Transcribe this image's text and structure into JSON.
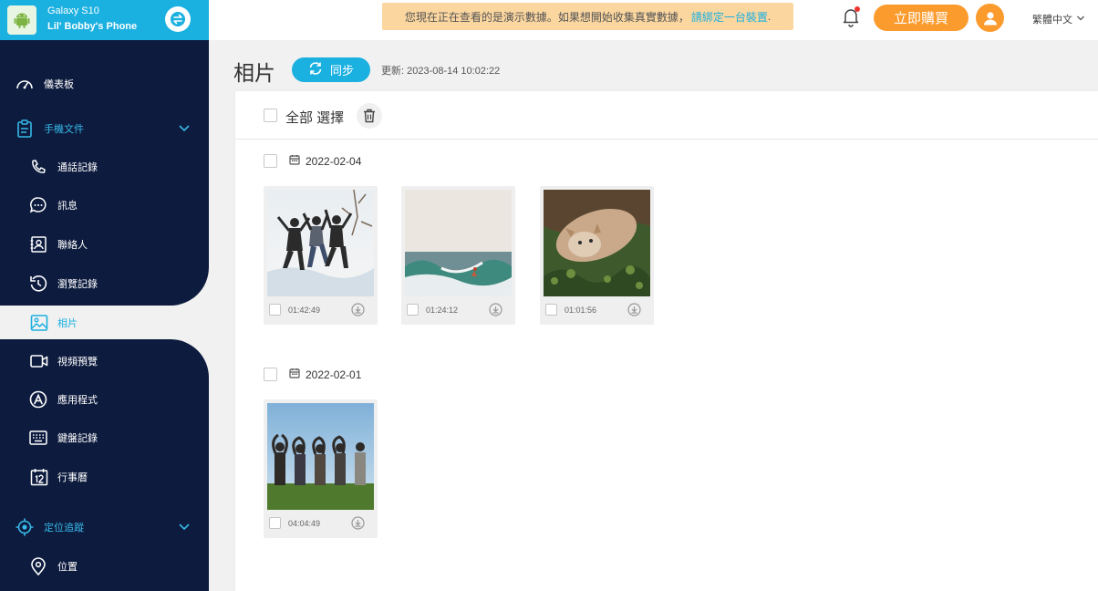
{
  "device": {
    "model": "Galaxy S10",
    "owner": "Lil' Bobby's Phone"
  },
  "sidebar": {
    "items": [
      {
        "label": "儀表板",
        "icon": "dashboard-icon"
      },
      {
        "label": "手機文件",
        "icon": "phone-files-icon",
        "group": true
      },
      {
        "label": "通話記錄",
        "icon": "phone-icon"
      },
      {
        "label": "訊息",
        "icon": "message-icon"
      },
      {
        "label": "聯絡人",
        "icon": "contacts-icon"
      },
      {
        "label": "瀏覽記錄",
        "icon": "history-icon"
      },
      {
        "label": "相片",
        "icon": "photo-icon",
        "active": true
      },
      {
        "label": "視頻預覽",
        "icon": "video-icon"
      },
      {
        "label": "應用程式",
        "icon": "apps-icon"
      },
      {
        "label": "鍵盤記錄",
        "icon": "keyboard-icon"
      },
      {
        "label": "行事曆",
        "icon": "calendar-icon"
      },
      {
        "label": "定位追蹤",
        "icon": "location-target-icon",
        "group": true
      },
      {
        "label": "位置",
        "icon": "location-pin-icon"
      }
    ]
  },
  "topbar": {
    "notice_text": "您現在正在查看的是演示數據。如果想開始收集真實數據，",
    "notice_link": "請綁定一台裝置",
    "notice_end": ".",
    "buy_label": "立即購買",
    "language": "繁體中文"
  },
  "page": {
    "title": "相片",
    "sync_label": "同步",
    "updated": "更新:  2023-08-14 10:02:22",
    "select_all": "全部 選擇"
  },
  "groups": [
    {
      "date": "2022-02-04",
      "photos": [
        {
          "time": "01:42:49",
          "scene": "jumping-friends"
        },
        {
          "time": "01:24:12",
          "scene": "surfer-wave"
        },
        {
          "time": "01:01:56",
          "scene": "cat-on-grass"
        }
      ]
    },
    {
      "date": "2022-02-01",
      "photos": [
        {
          "time": "04:04:49",
          "scene": "friends-hearts"
        }
      ]
    }
  ],
  "colors": {
    "accent": "#1ab0e0",
    "sidebar": "#0d1b3e",
    "buy": "#fc9b2d",
    "notice": "#fbd69f"
  }
}
